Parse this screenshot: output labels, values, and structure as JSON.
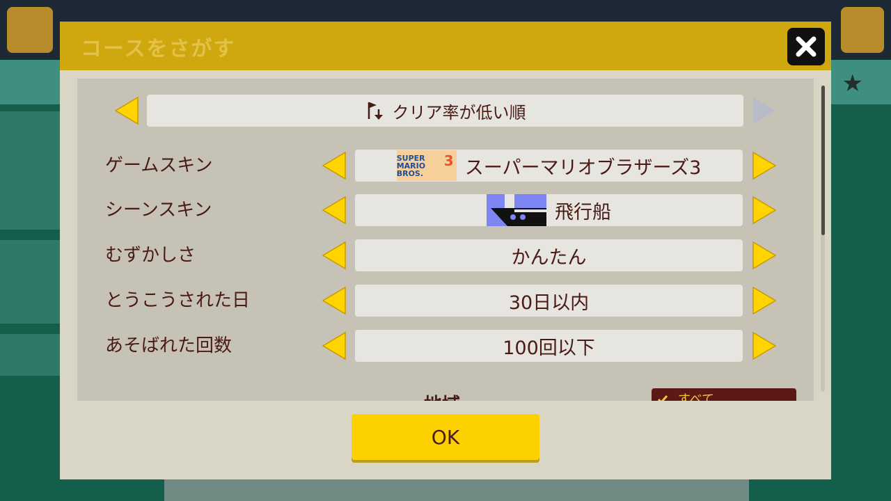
{
  "background": {
    "title": "コースをさがす"
  },
  "dialog": {
    "sort": {
      "label": "クリア率が低い順",
      "icon": "flag-down-icon"
    },
    "filters": [
      {
        "label": "ゲームスキン",
        "value": "スーパーマリオブラザーズ3",
        "thumbnail": "smb3-logo-icon"
      },
      {
        "label": "シーンスキン",
        "value": "飛行船",
        "thumbnail": "airship-icon"
      },
      {
        "label": "むずかしさ",
        "value": "かんたん"
      },
      {
        "label": "とうこうされた日",
        "value": "30日以内"
      },
      {
        "label": "あそばれた回数",
        "value": "100回以下"
      }
    ],
    "region": {
      "label": "地域",
      "all_label": "すべて"
    },
    "ok_label": "OK"
  },
  "colors": {
    "accent": "#fdd000",
    "text": "#4a1a14",
    "header": "#cfa80f",
    "arrow": "#ffd400"
  }
}
